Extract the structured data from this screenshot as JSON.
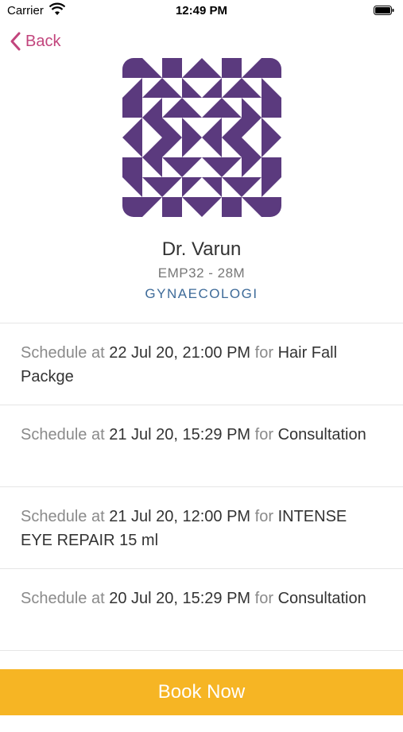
{
  "status_bar": {
    "carrier": "Carrier",
    "time": "12:49 PM"
  },
  "nav": {
    "back_label": "Back"
  },
  "profile": {
    "name": "Dr. Varun",
    "emp_info": "EMP32 - 28M",
    "department": "GYNAECOLOGI",
    "avatar_color": "#5b3a7e"
  },
  "schedules": [
    {
      "prefix": "Schedule at",
      "datetime": "22 Jul 20, 21:00 PM",
      "for_word": "for",
      "service": "Hair Fall Packge"
    },
    {
      "prefix": "Schedule at",
      "datetime": "21 Jul 20, 15:29 PM",
      "for_word": "for",
      "service": "Consultation"
    },
    {
      "prefix": "Schedule at",
      "datetime": "21 Jul 20, 12:00 PM",
      "for_word": "for",
      "service": "INTENSE EYE REPAIR 15 ml"
    },
    {
      "prefix": "Schedule at",
      "datetime": "20 Jul 20, 15:29 PM",
      "for_word": "for",
      "service": "Consultation"
    }
  ],
  "footer": {
    "book_now_label": "Book Now",
    "accent": "#f6b524"
  }
}
